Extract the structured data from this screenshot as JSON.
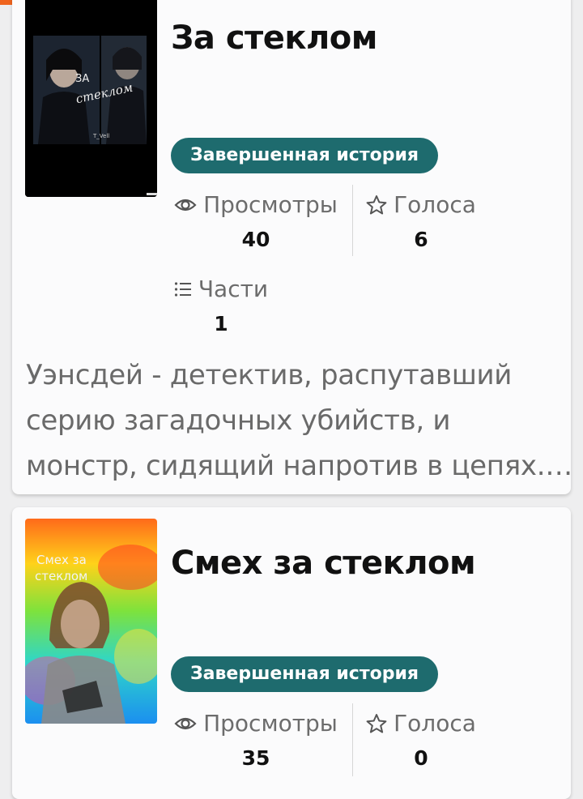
{
  "stories": [
    {
      "title": "За стеклом",
      "status_badge": "Завершенная история",
      "cover_text": {
        "line1": "ЗА",
        "line2": "стеклом",
        "author": "T_Vell"
      },
      "stats": {
        "views": {
          "label": "Просмотры",
          "value": "40"
        },
        "votes": {
          "label": "Голоса",
          "value": "6"
        },
        "parts": {
          "label": "Части",
          "value": "1"
        }
      },
      "description": [
        "Уэнсдей - детектив, распутавший",
        "серию загадочных убийств, и",
        "монстр, сидящий напротив в цепях.…"
      ]
    },
    {
      "title": "Смех за стеклом",
      "status_badge": "Завершенная история",
      "cover_text": {
        "line1": "Смех за",
        "line2": "стеклом"
      },
      "stats": {
        "views": {
          "label": "Просмотры",
          "value": "35"
        },
        "votes": {
          "label": "Голоса",
          "value": "0"
        }
      }
    }
  ],
  "icons": {
    "views": "eye-icon",
    "votes": "star-icon",
    "parts": "list-icon"
  },
  "colors": {
    "badge_bg": "#1e6b6e",
    "accent_bar": "#f0641e"
  }
}
